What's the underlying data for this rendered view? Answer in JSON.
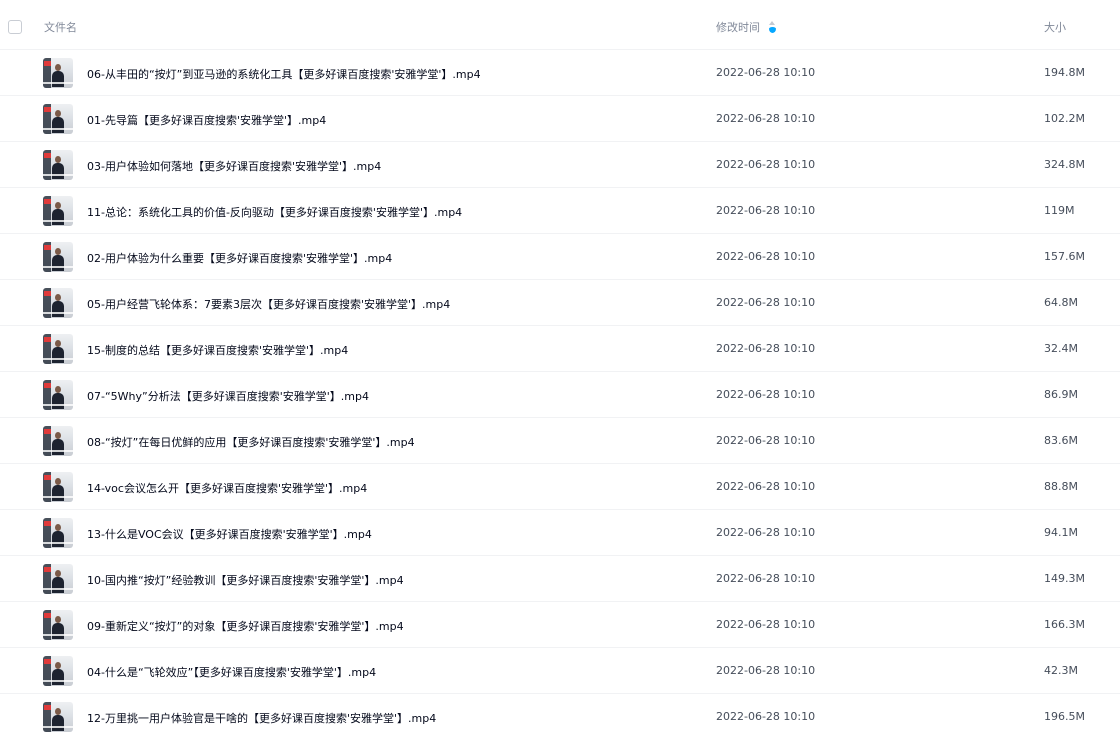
{
  "header": {
    "name_label": "文件名",
    "time_label": "修改时间",
    "size_label": "大小"
  },
  "files": [
    {
      "name": "06-从丰田的“按灯”到亚马逊的系统化工具【更多好课百度搜索'安雅学堂'】.mp4",
      "time": "2022-06-28 10:10",
      "size": "194.8M"
    },
    {
      "name": "01-先导篇【更多好课百度搜索'安雅学堂'】.mp4",
      "time": "2022-06-28 10:10",
      "size": "102.2M"
    },
    {
      "name": "03-用户体验如何落地【更多好课百度搜索'安雅学堂'】.mp4",
      "time": "2022-06-28 10:10",
      "size": "324.8M"
    },
    {
      "name": "11-总论：系统化工具的价值-反向驱动【更多好课百度搜索'安雅学堂'】.mp4",
      "time": "2022-06-28 10:10",
      "size": "119M"
    },
    {
      "name": "02-用户体验为什么重要【更多好课百度搜索'安雅学堂'】.mp4",
      "time": "2022-06-28 10:10",
      "size": "157.6M"
    },
    {
      "name": "05-用户经营飞轮体系：7要素3层次【更多好课百度搜索'安雅学堂'】.mp4",
      "time": "2022-06-28 10:10",
      "size": "64.8M"
    },
    {
      "name": "15-制度的总结【更多好课百度搜索'安雅学堂'】.mp4",
      "time": "2022-06-28 10:10",
      "size": "32.4M"
    },
    {
      "name": "07-“5Why”分析法【更多好课百度搜索'安雅学堂'】.mp4",
      "time": "2022-06-28 10:10",
      "size": "86.9M"
    },
    {
      "name": "08-“按灯”在每日优鲜的应用【更多好课百度搜索'安雅学堂'】.mp4",
      "time": "2022-06-28 10:10",
      "size": "83.6M"
    },
    {
      "name": "14-voc会议怎么开【更多好课百度搜索'安雅学堂'】.mp4",
      "time": "2022-06-28 10:10",
      "size": "88.8M"
    },
    {
      "name": "13-什么是VOC会议【更多好课百度搜索'安雅学堂'】.mp4",
      "time": "2022-06-28 10:10",
      "size": "94.1M"
    },
    {
      "name": "10-国内推“按灯”经验教训【更多好课百度搜索'安雅学堂'】.mp4",
      "time": "2022-06-28 10:10",
      "size": "149.3M"
    },
    {
      "name": "09-重新定义“按灯”的对象【更多好课百度搜索'安雅学堂'】.mp4",
      "time": "2022-06-28 10:10",
      "size": "166.3M"
    },
    {
      "name": "04-什么是“飞轮效应”【更多好课百度搜索'安雅学堂'】.mp4",
      "time": "2022-06-28 10:10",
      "size": "42.3M"
    },
    {
      "name": "12-万里挑一用户体验官是干啥的【更多好课百度搜索'安雅学堂'】.mp4",
      "time": "2022-06-28 10:10",
      "size": "196.5M"
    }
  ]
}
